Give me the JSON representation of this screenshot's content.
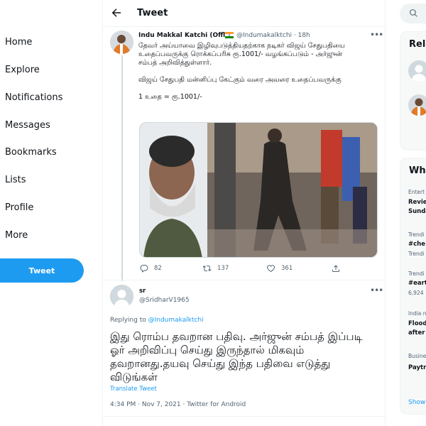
{
  "nav": {
    "items": [
      "Home",
      "Explore",
      "Notifications",
      "Messages",
      "Bookmarks",
      "Lists",
      "Profile",
      "More"
    ],
    "tweet_button": "Tweet"
  },
  "header": {
    "title": "Tweet"
  },
  "tweet": {
    "name": "Indu Makkal Katchi (Offl)",
    "handle": "@Indumakalktchi · 18h",
    "text_p1": "தேவர் அய்யாவை இழிவுபடுத்தியதற்காக நடிகர் விஜய் சேதுபதியை உதைப்பவருக்கு ரொக்கப்பரிசு ரூ.1001/- வழங்கப்படும் - அர்ஜுன் சம்பத் அறிவித்துள்ளார்.",
    "text_p2": "விஜய் சேதுபதி மன்னிப்பு கேட்கும் வரை அவரை உதைப்பவருக்கு",
    "text_p3": "1 உதை = ரூ.1001/-",
    "replies": "82",
    "retweets": "137",
    "likes": "361"
  },
  "reply": {
    "name": "sr",
    "handle": "@SridharV1965",
    "replying_prefix": "Replying to ",
    "replying_to": "@Indumakalktchi",
    "text": "இது ரொம்ப தவறான பதிவு. அர்ஜுன் சம்பத் இப்படி ஓர் அறிவிப்பு செய்து இருந்தால் மிகவும் தவறானது.தயவு செய்து இந்த பதிவை எடுத்து விடுங்கள்",
    "translate": "Translate Tweet",
    "meta": "4:34 PM · Nov 7, 2021 · Twitter for Android"
  },
  "right": {
    "relevant_title": "Rele",
    "whats_title": "Wha",
    "trends": [
      {
        "category": "Entert",
        "title": "Revie",
        "title2": "Sunda"
      },
      {
        "category": "Trendi",
        "title": "#che",
        "title2": "Trendi"
      },
      {
        "category": "Trendi",
        "title": "#eart",
        "title2": "6,924"
      },
      {
        "category": "India n",
        "title": "Flood",
        "title2": "after"
      },
      {
        "category": "Busine",
        "title": "Paytr",
        "title2": ""
      }
    ],
    "show_more": "Show"
  },
  "colors": {
    "accent": "#1d9bf0",
    "text": "#0f1419",
    "muted": "#536471",
    "border": "#eff3f4"
  }
}
